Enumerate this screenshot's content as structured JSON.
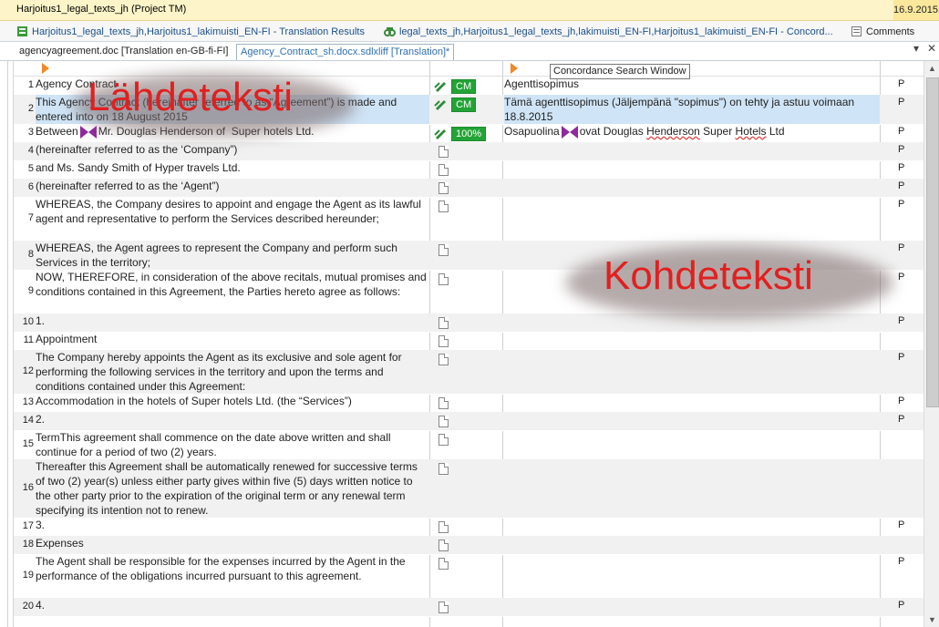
{
  "window": {
    "title": "Harjoitus1_legal_texts_jh (Project TM)",
    "date": "16.9.2015"
  },
  "view_tabs": [
    {
      "label": "Harjoitus1_legal_texts_jh,Harjoitus1_lakimuisti_EN-FI - Translation Results",
      "icon": "translation-results-icon"
    },
    {
      "label": "legal_texts_jh,Harjoitus1_legal_texts_jh,lakimuisti_EN-FI,Harjoitus1_lakimuisti_EN-FI - Concord...",
      "icon": "concordance-icon"
    },
    {
      "label": "Comments",
      "icon": "comments-icon"
    }
  ],
  "doc_tabs": [
    {
      "label": "agencyagreement.doc [Translation en-GB-fi-FI]"
    },
    {
      "label": "Agency_Contract_sh.docx.sdlxliff [Translation]*"
    }
  ],
  "tooltip": "Concordance Search Window",
  "overlays": {
    "source": "Lähdeteksti",
    "target": "Kohdeteksti"
  },
  "rows": [
    {
      "n": "1",
      "src": "Agency Contract",
      "status": "CM",
      "tgt": "Agenttisopimus",
      "p": "P"
    },
    {
      "n": "2",
      "src": "This Agency Contract (hereinafter referred to as “Agreement”) is made and entered into on 18 August 2015",
      "status": "CM",
      "tgt": "Tämä agenttisopimus (Jäljempänä \"sopimus\") on tehty ja astuu voimaan 18.8.2015",
      "p": "P"
    },
    {
      "n": "3",
      "src_pre": "Between",
      "src_post": "Mr. Douglas Henderson of  Super hotels Ltd.",
      "status": "100%",
      "tgt_pre": "Osapuolina",
      "tgt_post_a": "ovat Douglas ",
      "tgt_post_b": "Henderson",
      "tgt_post_c": " Super ",
      "tgt_post_d": "Hotels",
      "tgt_post_e": " Ltd",
      "p": "P"
    },
    {
      "n": "4",
      "src": "(hereinafter referred to as the ‘Company”)",
      "p": "P"
    },
    {
      "n": "5",
      "src": "and Ms. Sandy Smith of Hyper travels Ltd.",
      "p": "P"
    },
    {
      "n": "6",
      "src": "(hereinafter referred to as the ‘Agent”)",
      "p": "P"
    },
    {
      "n": "7",
      "src": "WHEREAS, the Company desires to appoint and engage the Agent as its lawful agent and representative to perform the Services described hereunder;",
      "p": "P"
    },
    {
      "n": "8",
      "src": "WHEREAS, the Agent agrees to represent the Company and perform such Services in the territory;",
      "p": "P"
    },
    {
      "n": "9",
      "src": "NOW, THEREFORE, in consideration of the above recitals, mutual promises and conditions contained in this Agreement, the Parties hereto agree as follows:",
      "p": "P"
    },
    {
      "n": "10",
      "src": "1.",
      "p": "P"
    },
    {
      "n": "11",
      "src": "Appointment",
      "p": ""
    },
    {
      "n": "12",
      "src": "The Company hereby appoints the Agent as its exclusive and sole agent for performing the following services in the territory and upon the terms and conditions contained under this Agreement:",
      "p": "P"
    },
    {
      "n": "13",
      "src": "Accommodation in the hotels of Super hotels Ltd. (the “Services”)",
      "p": "P"
    },
    {
      "n": "14",
      "src": "2.",
      "p": "P"
    },
    {
      "n": "15",
      "src": "TermThis agreement shall commence on the date above written and shall continue for a period of two (2) years.",
      "p": ""
    },
    {
      "n": "16",
      "src": "Thereafter this Agreement shall be automatically renewed for successive terms of two (2) year(s) unless either party gives within five (5) days written notice to the other party prior to the expiration of the original term or any renewal term specifying its intention not to renew.",
      "p": ""
    },
    {
      "n": "17",
      "src": "3.",
      "p": "P"
    },
    {
      "n": "18",
      "src": "Expenses",
      "p": ""
    },
    {
      "n": "19",
      "src": "The Agent shall be responsible for the expenses incurred by the Agent in the performance of the obligations incurred pursuant to this agreement.",
      "p": "P"
    },
    {
      "n": "20",
      "src": "4.",
      "p": "P"
    }
  ]
}
